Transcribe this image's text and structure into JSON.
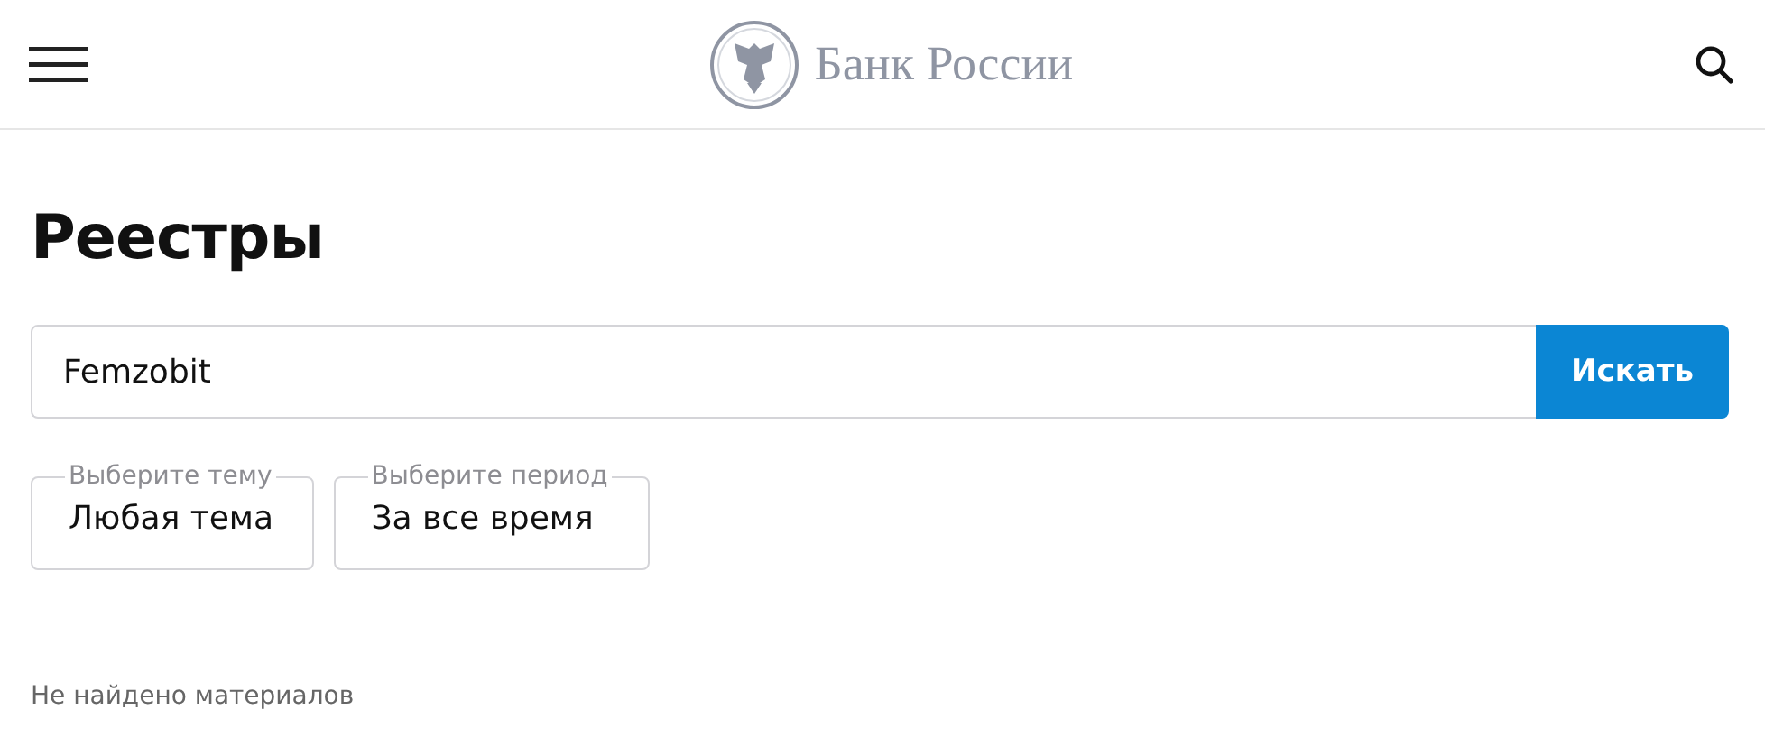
{
  "header": {
    "logo_text": "Банк России"
  },
  "title": "Реестры",
  "search": {
    "value": "Femzobit",
    "button": "Искать"
  },
  "filters": [
    {
      "label": "Выберите тему",
      "value": "Любая тема"
    },
    {
      "label": "Выберите период",
      "value": "За все время"
    }
  ],
  "result_message": "Не найдено материалов"
}
